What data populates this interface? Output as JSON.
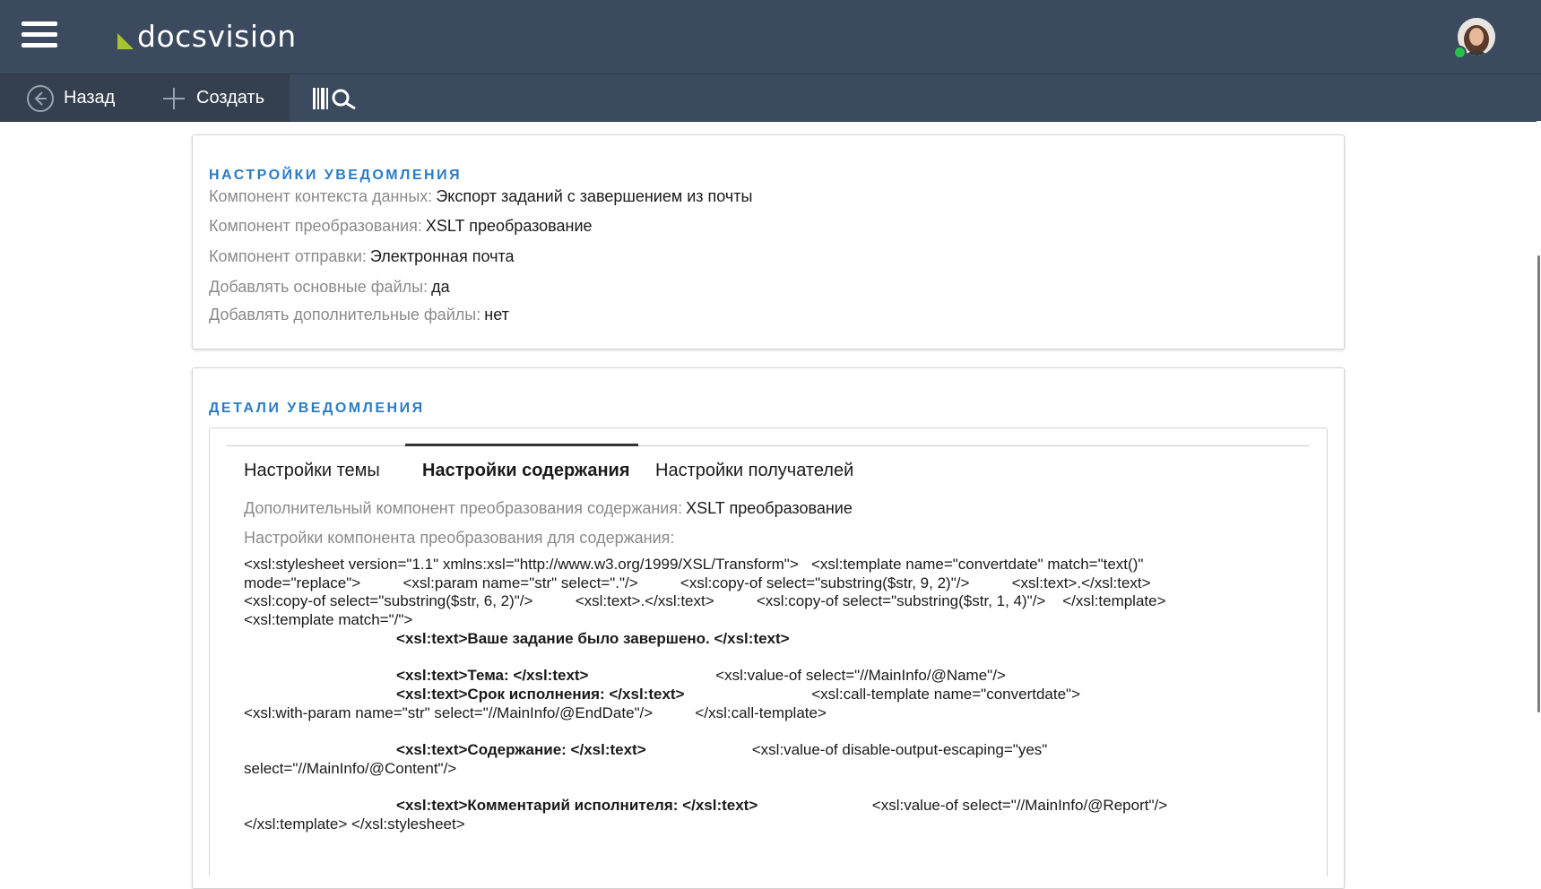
{
  "app": {
    "logo_text": "docsvision",
    "logo_color": "#a8c32f",
    "header_bg": "#3b4a5e"
  },
  "toolbar": {
    "back_label": "Назад",
    "create_label": "Создать",
    "search_icon": "barcode-search-icon"
  },
  "notification_settings": {
    "title": "НАСТРОЙКИ УВЕДОМЛЕНИЯ",
    "fields": [
      {
        "label": "Компонент контекста данных:",
        "value": "Экспорт заданий с завершением из почты"
      },
      {
        "label": "Компонент преобразования:",
        "value": "XSLT преобразование"
      },
      {
        "label": "Компонент отправки:",
        "value": "Электронная почта"
      },
      {
        "label": "Добавлять основные файлы:",
        "value": "да"
      },
      {
        "label": "Добавлять дополнительные файлы:",
        "value": "нет"
      }
    ]
  },
  "notification_details": {
    "title": "ДЕТАЛИ УВЕДОМЛЕНИЯ",
    "tabs": [
      {
        "label": "Настройки темы",
        "active": false
      },
      {
        "label": "Настройки содержания",
        "active": true
      },
      {
        "label": "Настройки получателей",
        "active": false
      }
    ],
    "extra_component_label": "Дополнительный компонент преобразования содержания:",
    "extra_component_value": "XSLT преобразование",
    "settings_label": "Настройки компонента преобразования для содержания:",
    "xsl_lines": [
      {
        "parts": [
          {
            "t": "<xsl:stylesheet version=\"1.1\" xmlns:xsl=\"http://www.w3.org/1999/XSL/Transform\">   <xsl:template name=\"convertdate\" match=\"text()\"",
            "b": false
          }
        ]
      },
      {
        "parts": [
          {
            "t": "mode=\"replace\">          <xsl:param name=\"str\" select=\".\"/>          <xsl:copy-of select=\"substring($str, 9, 2)\"/>          <xsl:text>.</xsl:text>",
            "b": false
          }
        ]
      },
      {
        "parts": [
          {
            "t": "<xsl:copy-of select=\"substring($str, 6, 2)\"/>          <xsl:text>.</xsl:text>          <xsl:copy-of select=\"substring($str, 1, 4)\"/>    </xsl:template>",
            "b": false
          }
        ]
      },
      {
        "parts": [
          {
            "t": "<xsl:template match=\"/\">",
            "b": false
          }
        ]
      },
      {
        "parts": [
          {
            "t": "                                    ",
            "b": false
          },
          {
            "t": "<xsl:text>Ваше задание было завершено. </xsl:text>",
            "b": true
          }
        ]
      },
      {
        "parts": [
          {
            "t": "",
            "b": false
          }
        ]
      },
      {
        "parts": [
          {
            "t": "                                    ",
            "b": false
          },
          {
            "t": "<xsl:text>Тема: </xsl:text>",
            "b": true
          },
          {
            "t": "                              <xsl:value-of select=\"//MainInfo/@Name\"/>",
            "b": false
          }
        ]
      },
      {
        "parts": [
          {
            "t": "                                    ",
            "b": false
          },
          {
            "t": "<xsl:text>Срок исполнения: </xsl:text>",
            "b": true
          },
          {
            "t": "                              <xsl:call-template name=\"convertdate\">",
            "b": false
          }
        ]
      },
      {
        "parts": [
          {
            "t": "<xsl:with-param name=\"str\" select=\"//MainInfo/@EndDate\"/>          </xsl:call-template>",
            "b": false
          }
        ]
      },
      {
        "parts": [
          {
            "t": "",
            "b": false
          }
        ]
      },
      {
        "parts": [
          {
            "t": "                                    ",
            "b": false
          },
          {
            "t": "<xsl:text>Содержание: </xsl:text>",
            "b": true
          },
          {
            "t": "                         <xsl:value-of disable-output-escaping=\"yes\"",
            "b": false
          }
        ]
      },
      {
        "parts": [
          {
            "t": "select=\"//MainInfo/@Content\"/>",
            "b": false
          }
        ]
      },
      {
        "parts": [
          {
            "t": "",
            "b": false
          }
        ]
      },
      {
        "parts": [
          {
            "t": "                                    ",
            "b": false
          },
          {
            "t": "<xsl:text>Комментарий исполнителя: </xsl:text>",
            "b": true
          },
          {
            "t": "                           <xsl:value-of select=\"//MainInfo/@Report\"/>",
            "b": false
          }
        ]
      },
      {
        "parts": [
          {
            "t": "</xsl:template> </xsl:stylesheet>",
            "b": false
          }
        ]
      }
    ]
  }
}
